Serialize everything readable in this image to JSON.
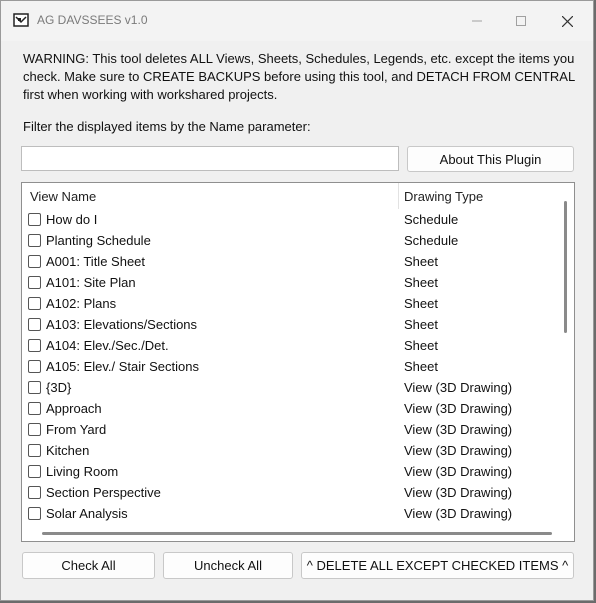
{
  "window": {
    "title": "AG DAVSSEES v1.0",
    "min_icon": "minimize-icon",
    "max_icon": "maximize-icon",
    "close_icon": "close-icon"
  },
  "warning_text": "WARNING: This tool deletes ALL Views, Sheets, Schedules, Legends, etc. except the items you check. Make sure to CREATE BACKUPS before using this tool, and DETACH FROM CENTRAL first when working with workshared projects.",
  "filter": {
    "label": "Filter the displayed items by the Name parameter:",
    "value": "",
    "placeholder": ""
  },
  "about_button": "About This Plugin",
  "list": {
    "columns": [
      "View Name",
      "Drawing Type"
    ],
    "rows": [
      {
        "name": "How do I",
        "type": "Schedule",
        "checked": false
      },
      {
        "name": "Planting Schedule",
        "type": "Schedule",
        "checked": false
      },
      {
        "name": "A001: Title Sheet",
        "type": "Sheet",
        "checked": false
      },
      {
        "name": "A101: Site Plan",
        "type": "Sheet",
        "checked": false
      },
      {
        "name": "A102: Plans",
        "type": "Sheet",
        "checked": false
      },
      {
        "name": "A103: Elevations/Sections",
        "type": "Sheet",
        "checked": false
      },
      {
        "name": "A104: Elev./Sec./Det.",
        "type": "Sheet",
        "checked": false
      },
      {
        "name": "A105: Elev./ Stair Sections",
        "type": "Sheet",
        "checked": false
      },
      {
        "name": "{3D}",
        "type": "View (3D Drawing)",
        "checked": false
      },
      {
        "name": "Approach",
        "type": "View (3D Drawing)",
        "checked": false
      },
      {
        "name": "From Yard",
        "type": "View (3D Drawing)",
        "checked": false
      },
      {
        "name": "Kitchen",
        "type": "View (3D Drawing)",
        "checked": false
      },
      {
        "name": "Living Room",
        "type": "View (3D Drawing)",
        "checked": false
      },
      {
        "name": "Section Perspective",
        "type": "View (3D Drawing)",
        "checked": false
      },
      {
        "name": "Solar Analysis",
        "type": "View (3D Drawing)",
        "checked": false
      }
    ]
  },
  "buttons": {
    "check_all": "Check All",
    "uncheck_all": "Uncheck All",
    "delete": "^ DELETE ALL EXCEPT CHECKED ITEMS ^"
  }
}
